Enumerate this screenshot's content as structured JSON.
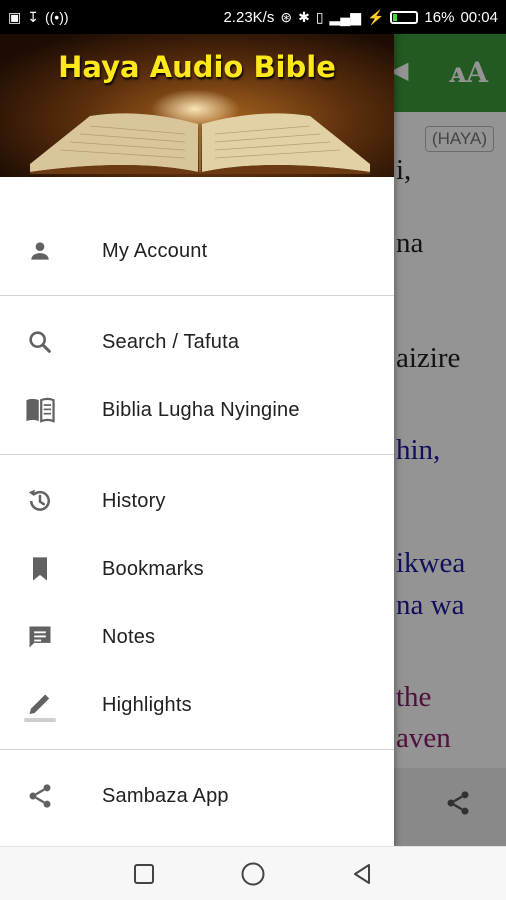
{
  "status_bar": {
    "network_speed": "2.23K/s",
    "battery_percent": "16%",
    "time": "00:04",
    "battery_level": 0.16,
    "battery_color": "#3ddc3d"
  },
  "drawer": {
    "header_title": "Haya Audio Bible",
    "header_title_color": "#ffe81a",
    "groups": [
      [
        {
          "icon": "person-icon",
          "label": "My Account"
        }
      ],
      [
        {
          "icon": "search-icon",
          "label": "Search / Tafuta"
        },
        {
          "icon": "book-open-icon",
          "label": "Biblia Lugha Nyingine"
        }
      ],
      [
        {
          "icon": "history-icon",
          "label": "History"
        },
        {
          "icon": "bookmark-icon",
          "label": "Bookmarks"
        },
        {
          "icon": "notes-icon",
          "label": "Notes"
        },
        {
          "icon": "highlighter-icon",
          "label": "Highlights"
        }
      ],
      [
        {
          "icon": "share-icon",
          "label": "Sambaza App"
        }
      ]
    ]
  },
  "background": {
    "appbar_color": "#3b9b3b",
    "version_badge": "(HAYA)",
    "text_lines": [
      {
        "text": "i,",
        "color": "#222222"
      },
      {
        "text": "na",
        "color": "#222222"
      },
      {
        "text": "aizire",
        "color": "#222222"
      },
      {
        "text": "hin,",
        "color": "#1a1aa0"
      },
      {
        "text": "ikwea",
        "color": "#1a1aa0"
      },
      {
        "text": "na wa",
        "color": "#1a1aa0"
      },
      {
        "text": "the",
        "color": "#8a1a6a"
      },
      {
        "text": "aven",
        "color": "#8a1a6a"
      }
    ]
  }
}
